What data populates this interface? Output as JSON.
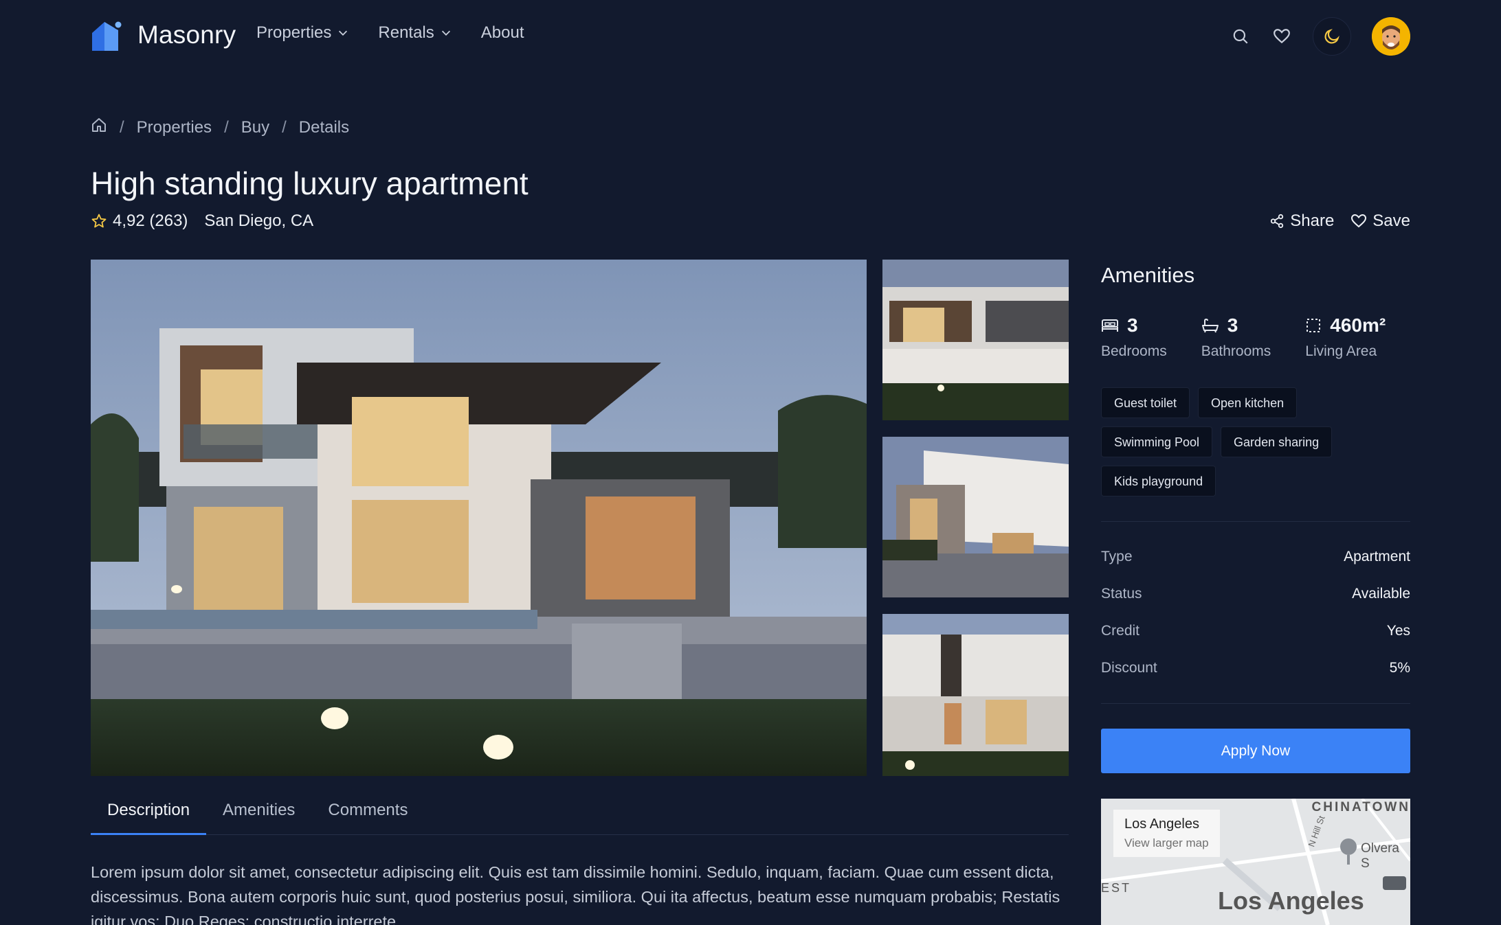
{
  "header": {
    "brand": "Masonry",
    "nav": [
      {
        "label": "Properties",
        "has_dropdown": true
      },
      {
        "label": "Rentals",
        "has_dropdown": true
      },
      {
        "label": "About",
        "has_dropdown": false
      }
    ],
    "icons": [
      "search-icon",
      "heart-icon",
      "moon-icon",
      "avatar"
    ]
  },
  "breadcrumb": [
    "Properties",
    "Buy",
    "Details"
  ],
  "listing": {
    "title": "High standing luxury apartment",
    "rating": "4,92 (263)",
    "location": "San Diego, CA",
    "share_label": "Share",
    "save_label": "Save"
  },
  "tabs": [
    {
      "label": "Description",
      "active": true
    },
    {
      "label": "Amenities",
      "active": false
    },
    {
      "label": "Comments",
      "active": false
    }
  ],
  "description": "Lorem ipsum dolor sit amet, consectetur adipiscing elit. Quis est tam dissimile homini. Sedulo, inquam, faciam. Quae cum essent dicta, discessimus. Bona autem corporis huic sunt, quod posterius posui, similiora. Qui ita affectus, beatum esse numquam probabis; Restatis igitur vos; Duo Reges: constructio interrete.",
  "sidebar": {
    "amenities_title": "Amenities",
    "stats": [
      {
        "value": "3",
        "label": "Bedrooms",
        "icon": "bed-icon"
      },
      {
        "value": "3",
        "label": "Bathrooms",
        "icon": "bath-icon"
      },
      {
        "value": "460m²",
        "label": "Living Area",
        "icon": "area-icon"
      }
    ],
    "chips": [
      "Guest toilet",
      "Open kitchen",
      "Swimming Pool",
      "Garden sharing",
      "Kids playground"
    ],
    "details": [
      {
        "key": "Type",
        "value": "Apartment"
      },
      {
        "key": "Status",
        "value": "Available"
      },
      {
        "key": "Credit",
        "value": "Yes"
      },
      {
        "key": "Discount",
        "value": "5%"
      }
    ],
    "apply_label": "Apply Now",
    "map": {
      "place": "Los Angeles",
      "link": "View larger map",
      "labels": [
        "CHINATOWN",
        "Olvera S",
        "N Hill St",
        "Los Angeles",
        "EST"
      ]
    }
  },
  "colors": {
    "background": "#121a2e",
    "accent": "#3b82f6",
    "chip_bg": "#0a101e"
  }
}
